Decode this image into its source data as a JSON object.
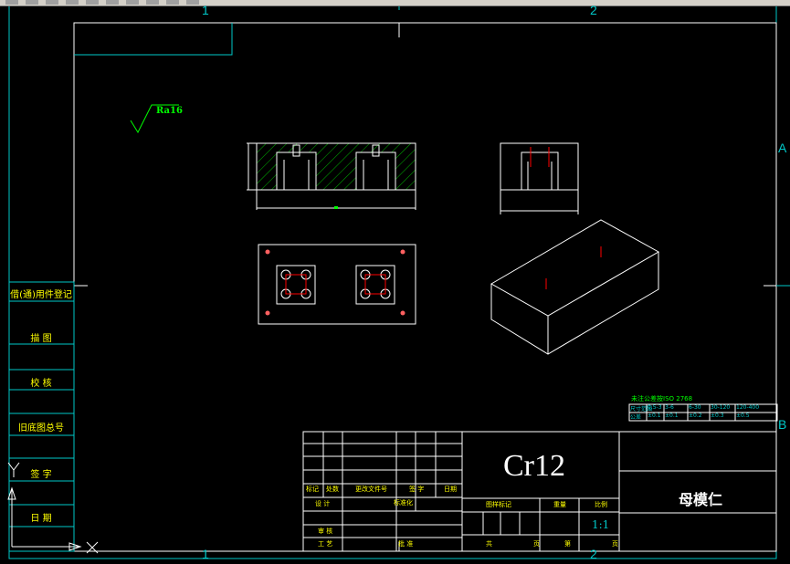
{
  "toolbar": {
    "buttons": [
      "open-icon",
      "save-icon",
      "undo-icon",
      "redo-icon",
      "pan-icon",
      "zoom-icon",
      "layer-icon",
      "properties-icon",
      "match-icon",
      "help-icon"
    ]
  },
  "frame": {
    "zones_top": [
      "1",
      "2"
    ],
    "zones_bottom": [
      "1",
      "2"
    ],
    "zones_right": [
      "A",
      "B"
    ]
  },
  "roughness": {
    "symbol": "Ra16"
  },
  "side_table": {
    "rows": [
      "借(通)用件登记",
      "描 图",
      "校 核",
      "旧底图总号",
      "签 字",
      "日 期"
    ]
  },
  "tolerance_table": {
    "title": "未注公差按ISO 2768",
    "header_row": [
      "尺寸范围",
      "0.5-3",
      "3-6",
      "6-30",
      "30-120",
      "120-400"
    ],
    "value_row": [
      "公差",
      "±0.1",
      "±0.1",
      "±0.2",
      "±0.3",
      "±0.5"
    ]
  },
  "title_block": {
    "material": "Cr12",
    "part_name": "母模仁",
    "scale": "1:1",
    "labels": {
      "mark": "标记",
      "count": "处数",
      "change_doc": "更改文件号",
      "sign": "签 字",
      "date": "日期",
      "design": "设 计",
      "standardize": "标准化",
      "review": "审 核",
      "process": "工 艺",
      "approve": "批 准",
      "stage_mark": "图样标记",
      "weight": "重量",
      "scale_label": "比例",
      "sheet_total": "共",
      "sheet_unit": "页",
      "sheet_no": "第",
      "sheet_unit2": "页"
    }
  },
  "colors": {
    "frame": "#00c8c8",
    "geometry": "#ffffff",
    "dimension": "#00ff00",
    "hidden": "#ff0000",
    "text": "#ffff00"
  }
}
